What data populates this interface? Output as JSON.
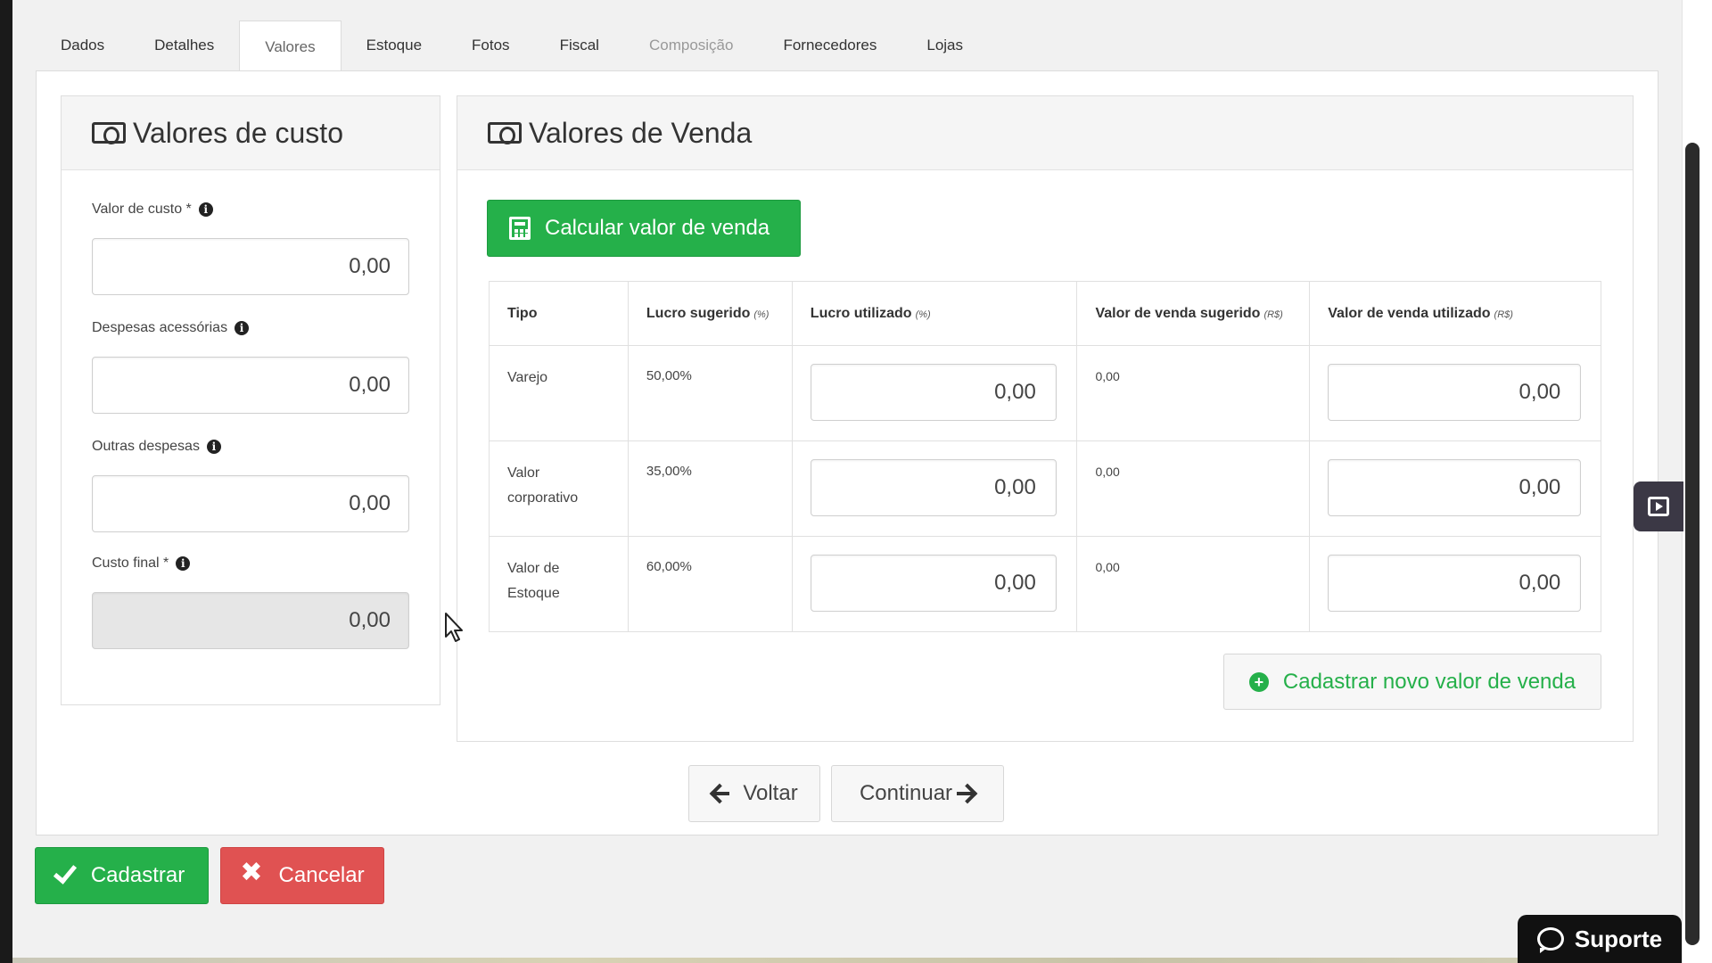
{
  "tabs": [
    {
      "label": "Dados"
    },
    {
      "label": "Detalhes"
    },
    {
      "label": "Valores"
    },
    {
      "label": "Estoque"
    },
    {
      "label": "Fotos"
    },
    {
      "label": "Fiscal"
    },
    {
      "label": "Composição"
    },
    {
      "label": "Fornecedores"
    },
    {
      "label": "Lojas"
    }
  ],
  "active_tab": "Valores",
  "cost": {
    "title": "Valores de custo",
    "valor_custo_label": "Valor de custo *",
    "valor_custo": "0,00",
    "despesas_label": "Despesas acessórias",
    "despesas": "0,00",
    "outras_label": "Outras despesas",
    "outras": "0,00",
    "custo_final_label": "Custo final *",
    "custo_final": "0,00"
  },
  "sale": {
    "title": "Valores de Venda",
    "calc_button": "Calcular valor de venda",
    "columns": {
      "tipo": "Tipo",
      "lucro_sugerido": "Lucro sugerido",
      "lucro_sugerido_unit": "(%)",
      "lucro_utilizado": "Lucro utilizado",
      "lucro_utilizado_unit": "(%)",
      "venda_sugerido": "Valor de venda sugerido",
      "venda_sugerido_unit": "(R$)",
      "venda_utilizado": "Valor de venda utilizado",
      "venda_utilizado_unit": "(R$)"
    },
    "rows": [
      {
        "tipo_line1": "Varejo",
        "tipo_line2": "",
        "lucro_sugerido": "50,00%",
        "lucro_utilizado": "0,00",
        "venda_sugerido": "0,00",
        "venda_utilizado": "0,00"
      },
      {
        "tipo_line1": "Valor",
        "tipo_line2": "corporativo",
        "lucro_sugerido": "35,00%",
        "lucro_utilizado": "0,00",
        "venda_sugerido": "0,00",
        "venda_utilizado": "0,00"
      },
      {
        "tipo_line1": "Valor de",
        "tipo_line2": "Estoque",
        "lucro_sugerido": "60,00%",
        "lucro_utilizado": "0,00",
        "venda_sugerido": "0,00",
        "venda_utilizado": "0,00"
      }
    ],
    "new_button": "Cadastrar novo valor de venda"
  },
  "nav": {
    "back": "Voltar",
    "next": "Continuar"
  },
  "actions": {
    "save": "Cadastrar",
    "cancel": "Cancelar"
  },
  "support": "Suporte",
  "icons": {
    "money": "money-bill-icon",
    "info": "info-circle-icon",
    "calculator": "calculator-icon",
    "plus": "plus-circle-icon",
    "arrow_left": "arrow-left-icon",
    "arrow_right": "arrow-right-icon",
    "check": "check-icon",
    "close": "close-icon",
    "chat": "chat-icon",
    "side": "side-panel-icon"
  },
  "colors": {
    "green": "#25b04a",
    "red": "#e05252",
    "support_bg": "#111111",
    "side_tab_bg": "#3b3845"
  }
}
